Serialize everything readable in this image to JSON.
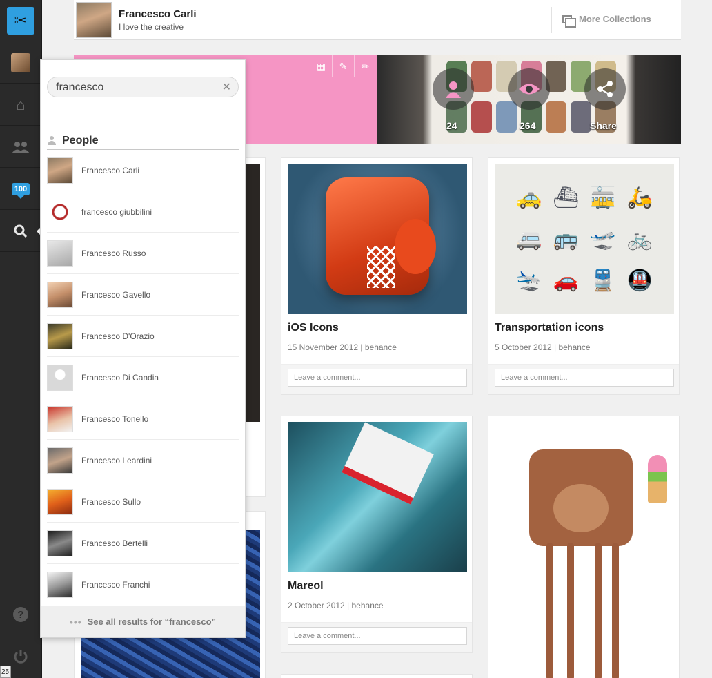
{
  "rail": {
    "logo_icon": "scissors-icon",
    "badge_count": "100",
    "corner_label": "25"
  },
  "header": {
    "name": "Francesco Carli",
    "tagline": "I love the creative",
    "more_collections": "More Collections"
  },
  "banner": {
    "stats": [
      {
        "icon": "person-icon",
        "value": "24"
      },
      {
        "icon": "eye-icon",
        "value": "264"
      },
      {
        "icon": "share-icon",
        "value": "Share"
      }
    ]
  },
  "search": {
    "query": "francesco",
    "section_title": "People",
    "results": [
      {
        "name": "Francesco Carli"
      },
      {
        "name": "francesco giubbilini"
      },
      {
        "name": "Francesco Russo"
      },
      {
        "name": "Francesco Gavello"
      },
      {
        "name": "Francesco D'Orazio"
      },
      {
        "name": "Francesco Di Candia"
      },
      {
        "name": "Francesco Tonello"
      },
      {
        "name": "Francesco Leardini"
      },
      {
        "name": "Francesco Sullo"
      },
      {
        "name": "Francesco Bertelli"
      },
      {
        "name": "Francesco Franchi"
      }
    ],
    "see_all": "See all results for “francesco”"
  },
  "cards": [
    {
      "title": "iOS Icons",
      "meta": "15 November 2012 | behance",
      "comment_placeholder": "Leave a comment..."
    },
    {
      "title": "Transportation icons",
      "meta": "5 October 2012 | behance",
      "comment_placeholder": "Leave a comment..."
    },
    {
      "title": "Mareol",
      "meta": "2 October 2012 | behance",
      "comment_placeholder": "Leave a comment..."
    }
  ],
  "colors": {
    "accent": "#2f9fe0",
    "banner_pink": "#f595c4",
    "rail_bg": "#2a2a2a"
  }
}
